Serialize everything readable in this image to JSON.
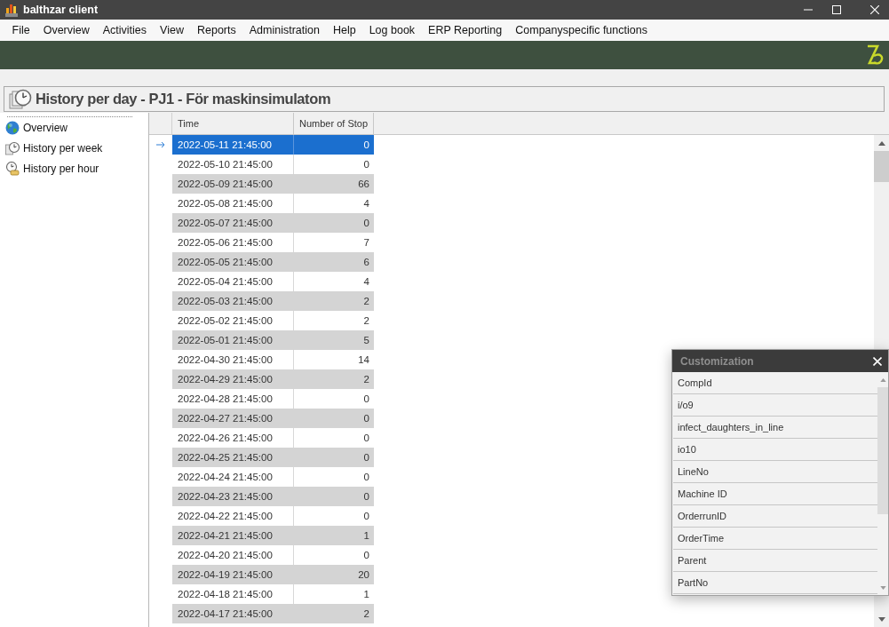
{
  "window": {
    "title": "balthzar client"
  },
  "menu": [
    "File",
    "Overview",
    "Activities",
    "View",
    "Reports",
    "Administration",
    "Help",
    "Log book",
    "ERP Reporting",
    "Companyspecific functions"
  ],
  "page_header": {
    "title": "History per day - PJ1 - För maskinsimulatom"
  },
  "sidebar": {
    "items": [
      "Overview",
      "History per week",
      "History per hour"
    ]
  },
  "table": {
    "columns": [
      "Time",
      "Number of Stop"
    ],
    "rows": [
      {
        "time": "2022-05-11 21:45:00",
        "stops": "0",
        "selected": true
      },
      {
        "time": "2022-05-10 21:45:00",
        "stops": "0",
        "selected": false
      },
      {
        "time": "2022-05-09 21:45:00",
        "stops": "66",
        "selected": false
      },
      {
        "time": "2022-05-08 21:45:00",
        "stops": "4",
        "selected": false
      },
      {
        "time": "2022-05-07 21:45:00",
        "stops": "0",
        "selected": false
      },
      {
        "time": "2022-05-06 21:45:00",
        "stops": "7",
        "selected": false
      },
      {
        "time": "2022-05-05 21:45:00",
        "stops": "6",
        "selected": false
      },
      {
        "time": "2022-05-04 21:45:00",
        "stops": "4",
        "selected": false
      },
      {
        "time": "2022-05-03 21:45:00",
        "stops": "2",
        "selected": false
      },
      {
        "time": "2022-05-02 21:45:00",
        "stops": "2",
        "selected": false
      },
      {
        "time": "2022-05-01 21:45:00",
        "stops": "5",
        "selected": false
      },
      {
        "time": "2022-04-30 21:45:00",
        "stops": "14",
        "selected": false
      },
      {
        "time": "2022-04-29 21:45:00",
        "stops": "2",
        "selected": false
      },
      {
        "time": "2022-04-28 21:45:00",
        "stops": "0",
        "selected": false
      },
      {
        "time": "2022-04-27 21:45:00",
        "stops": "0",
        "selected": false
      },
      {
        "time": "2022-04-26 21:45:00",
        "stops": "0",
        "selected": false
      },
      {
        "time": "2022-04-25 21:45:00",
        "stops": "0",
        "selected": false
      },
      {
        "time": "2022-04-24 21:45:00",
        "stops": "0",
        "selected": false
      },
      {
        "time": "2022-04-23 21:45:00",
        "stops": "0",
        "selected": false
      },
      {
        "time": "2022-04-22 21:45:00",
        "stops": "0",
        "selected": false
      },
      {
        "time": "2022-04-21 21:45:00",
        "stops": "1",
        "selected": false
      },
      {
        "time": "2022-04-20 21:45:00",
        "stops": "0",
        "selected": false
      },
      {
        "time": "2022-04-19 21:45:00",
        "stops": "20",
        "selected": false
      },
      {
        "time": "2022-04-18 21:45:00",
        "stops": "1",
        "selected": false
      },
      {
        "time": "2022-04-17 21:45:00",
        "stops": "2",
        "selected": false
      }
    ]
  },
  "customization": {
    "title": "Customization",
    "fields": [
      "CompId",
      "i/o9",
      "infect_daughters_in_line",
      "io10",
      "LineNo",
      "Machine ID",
      "OrderrunID",
      "OrderTime",
      "Parent",
      "PartNo"
    ]
  }
}
